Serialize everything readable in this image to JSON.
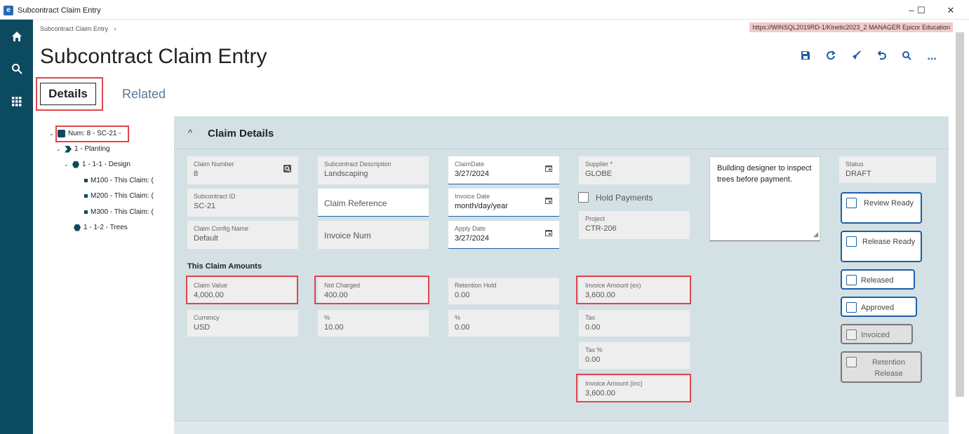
{
  "window": {
    "title": "Subcontract Claim Entry",
    "controls": {
      "minimize": "–",
      "maximize": "☐",
      "close": "✕"
    }
  },
  "rail": {
    "icons": [
      "home-icon",
      "search-icon",
      "apps-grid-icon"
    ]
  },
  "breadcrumb": {
    "text": "Subcontract Claim Entry",
    "sep": "›"
  },
  "server": {
    "text": "https://WINSQL2019RD-1/Kinetic2023_2   MANAGER   Epicor Education"
  },
  "page": {
    "title": "Subcontract Claim Entry"
  },
  "toolbar": {
    "icons": [
      "save-icon",
      "refresh-icon",
      "clear-icon",
      "undo-icon",
      "search-icon",
      "more-icon"
    ],
    "more": "..."
  },
  "tabs": {
    "details": "Details",
    "related": "Related"
  },
  "tree": {
    "root": "Num: 8 - SC-21 -",
    "items": [
      {
        "label": "1 - Planting"
      },
      {
        "label": "1 - 1-1 - Design"
      },
      {
        "label": "M100 - This Claim: ("
      },
      {
        "label": "M200 - This Claim: ("
      },
      {
        "label": "M300 - This Claim: ("
      },
      {
        "label": "1 - 1-2 - Trees"
      }
    ]
  },
  "section": {
    "title": "Claim Details"
  },
  "fields": {
    "claim_number": {
      "label": "Claim Number",
      "value": "8"
    },
    "subcontract_id": {
      "label": "Subcontract ID",
      "value": "SC-21"
    },
    "claim_config": {
      "label": "Claim Config Name",
      "value": "Default"
    },
    "subcontract_desc": {
      "label": "Subcontract Description",
      "value": "Landscaping"
    },
    "claim_reference": {
      "placeholder": "Claim Reference"
    },
    "invoice_num": {
      "placeholder": "Invoice Num"
    },
    "claim_date": {
      "label": "ClaimDate",
      "value": "3/27/2024"
    },
    "invoice_date": {
      "label": "Invoice Date",
      "value": "month/day/year"
    },
    "apply_date": {
      "label": "Apply Date",
      "value": "3/27/2024"
    },
    "supplier": {
      "label": "Supplier *",
      "value": "GLOBE"
    },
    "hold_payments": {
      "label": "Hold Payments"
    },
    "project": {
      "label": "Project",
      "value": "CTR-206"
    },
    "comment": "Building designer to inspect trees before payment.",
    "status": {
      "label": "Status",
      "value": "DRAFT"
    }
  },
  "amounts": {
    "heading": "This Claim Amounts",
    "claim_value": {
      "label": "Claim Value",
      "value": "4,000.00"
    },
    "currency": {
      "label": "Currency",
      "value": "USD"
    },
    "not_charged": {
      "label": "Not Charged",
      "value": "400.00"
    },
    "not_charged_pct": {
      "label": "%",
      "value": "10.00"
    },
    "retention_hold": {
      "label": "Retention Hold",
      "value": "0.00"
    },
    "retention_pct": {
      "label": "%",
      "value": "0.00"
    },
    "invoice_ex": {
      "label": "Invoice Amount (ex)",
      "value": "3,600.00"
    },
    "tax": {
      "label": "Tax",
      "value": "0.00"
    },
    "tax_pct": {
      "label": "Tax %",
      "value": "0.00"
    },
    "invoice_inc": {
      "label": "Invoice Amount (inc)",
      "value": "3,600.00"
    }
  },
  "status_buttons": {
    "review_ready": "Review Ready",
    "release_ready": "Release Ready",
    "released": "Released",
    "approved": "Approved",
    "invoiced": "Invoiced",
    "retention_release": "Retention Release"
  },
  "colors": {
    "rail": "#0c4a60",
    "accent": "#1f5ea8",
    "highlight": "#e0454b",
    "panel": "#d3e1e4"
  }
}
